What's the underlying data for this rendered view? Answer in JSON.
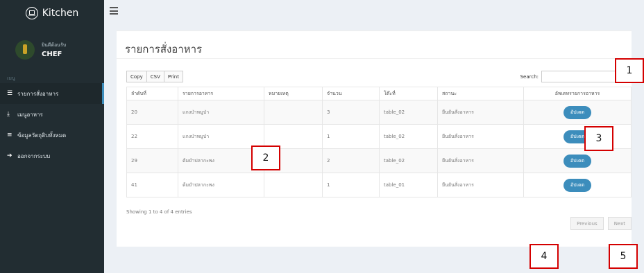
{
  "sidebar": {
    "brand": "Kitchen",
    "user": {
      "greeting": "ยินดีต้อนรับ",
      "role": "CHEF"
    },
    "menu_header": "เมนู",
    "items": [
      {
        "label": "รายการสั่งอาหาร",
        "icon": "list-icon"
      },
      {
        "label": "เมนูอาหาร",
        "icon": "download-icon"
      },
      {
        "label": "ข้อมูลวัตถุดิบทั้งหมด",
        "icon": "database-icon"
      },
      {
        "label": "ออกจากระบบ",
        "icon": "sign-out-icon"
      }
    ]
  },
  "main": {
    "title": "รายการสั่งอาหาร",
    "buttons": {
      "copy": "Copy",
      "csv": "CSV",
      "print": "Print"
    },
    "search_label": "Search:",
    "search_value": "",
    "table": {
      "headers": [
        "ลำดับที่",
        "รายการอาหาร",
        "หมายเหตุ",
        "จำนวน",
        "โต๊ะที่",
        "สถานะ",
        "อัพเดทรายการอาหาร"
      ],
      "rows": [
        {
          "id": "20",
          "item": "แกงป่าหมูป่า",
          "note": "",
          "qty": "3",
          "table": "table_02",
          "status": "ยืนยันสั่งอาหาร",
          "action": "อัปเดต"
        },
        {
          "id": "22",
          "item": "แกงป่าหมูป่า",
          "note": "",
          "qty": "1",
          "table": "table_02",
          "status": "ยืนยันสั่งอาหาร",
          "action": "อัปเดต"
        },
        {
          "id": "29",
          "item": "ต้มยำปลากะพง",
          "note": "",
          "qty": "2",
          "table": "table_02",
          "status": "ยืนยันสั่งอาหาร",
          "action": "อัปเดต"
        },
        {
          "id": "41",
          "item": "ต้มยำปลากะพง",
          "note": "",
          "qty": "1",
          "table": "table_01",
          "status": "ยืนยันสั่งอาหาร",
          "action": "อัปเดต"
        }
      ]
    },
    "info": "Showing 1 to 4 of 4 entries",
    "pager": {
      "previous": "Previous",
      "next": "Next"
    }
  },
  "markers": [
    "1",
    "2",
    "3",
    "4",
    "5"
  ]
}
